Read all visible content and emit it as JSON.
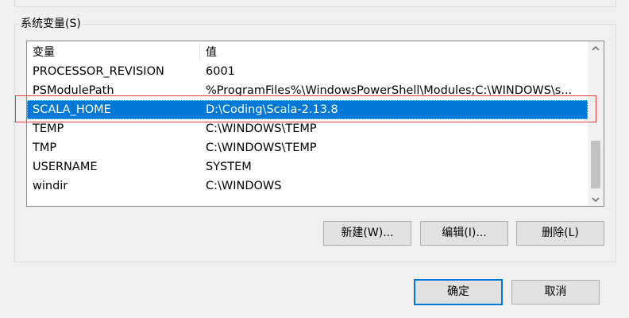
{
  "group": {
    "title": "系统变量(S)"
  },
  "list": {
    "headers": {
      "name": "变量",
      "value": "值"
    },
    "rows": [
      {
        "name": "PROCESSOR_REVISION",
        "value": "6001"
      },
      {
        "name": "PSModulePath",
        "value": "%ProgramFiles%\\WindowsPowerShell\\Modules;C:\\WINDOWS\\s..."
      },
      {
        "name": "SCALA_HOME",
        "value": "D:\\Coding\\Scala-2.13.8"
      },
      {
        "name": "TEMP",
        "value": "C:\\WINDOWS\\TEMP"
      },
      {
        "name": "TMP",
        "value": "C:\\WINDOWS\\TEMP"
      },
      {
        "name": "USERNAME",
        "value": "SYSTEM"
      },
      {
        "name": "windir",
        "value": "C:\\WINDOWS"
      }
    ],
    "selected_index": 2
  },
  "buttons": {
    "new": "新建(W)...",
    "edit": "编辑(I)...",
    "delete": "删除(L)",
    "ok": "确定",
    "cancel": "取消"
  },
  "colors": {
    "selection": "#0078d7",
    "annotation": "#e0413d"
  },
  "icons": {
    "scroll_up": "chevron-up-icon",
    "scroll_down": "chevron-down-icon"
  }
}
